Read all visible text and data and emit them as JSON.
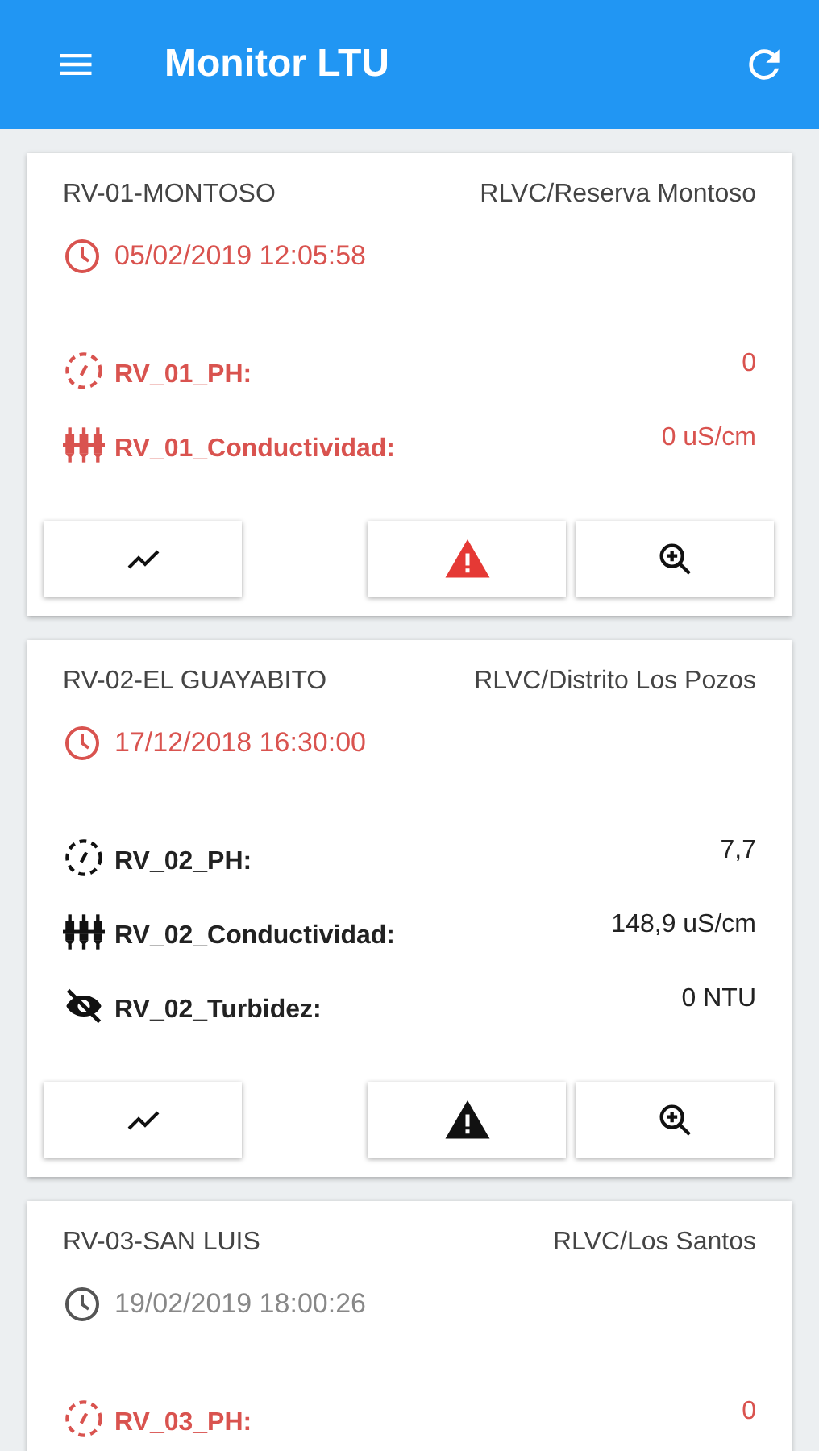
{
  "app_bar": {
    "title": "Monitor LTU"
  },
  "stations": [
    {
      "name": "RV-01-MONTOSO",
      "location": "RLVC/Reserva Montoso",
      "timestamp": "05/02/2019 12:05:58",
      "stale": true,
      "sensors": [
        {
          "kind": "ph",
          "label": "RV_01_PH:",
          "value": "0",
          "alarm": true
        },
        {
          "kind": "conductivity",
          "label": "RV_01_Conductividad:",
          "value": "0 uS/cm",
          "alarm": true
        }
      ],
      "actions": [
        {
          "kind": "chart"
        },
        {
          "kind": "alert",
          "alarm": true
        },
        {
          "kind": "zoom"
        }
      ]
    },
    {
      "name": "RV-02-EL GUAYABITO",
      "location": "RLVC/Distrito Los Pozos",
      "timestamp": "17/12/2018 16:30:00",
      "stale": true,
      "sensors": [
        {
          "kind": "ph",
          "label": "RV_02_PH:",
          "value": "7,7",
          "alarm": false
        },
        {
          "kind": "conductivity",
          "label": "RV_02_Conductividad:",
          "value": "148,9 uS/cm",
          "alarm": false
        },
        {
          "kind": "turbidity",
          "label": "RV_02_Turbidez:",
          "value": "0 NTU",
          "alarm": false
        }
      ],
      "actions": [
        {
          "kind": "chart"
        },
        {
          "kind": "alert",
          "alarm": false
        },
        {
          "kind": "zoom"
        }
      ]
    },
    {
      "name": "RV-03-SAN LUIS",
      "location": "RLVC/Los Santos",
      "timestamp": "19/02/2019 18:00:26",
      "stale": false,
      "sensors": [
        {
          "kind": "ph",
          "label": "RV_03_PH:",
          "value": "0",
          "alarm": true
        }
      ]
    }
  ]
}
